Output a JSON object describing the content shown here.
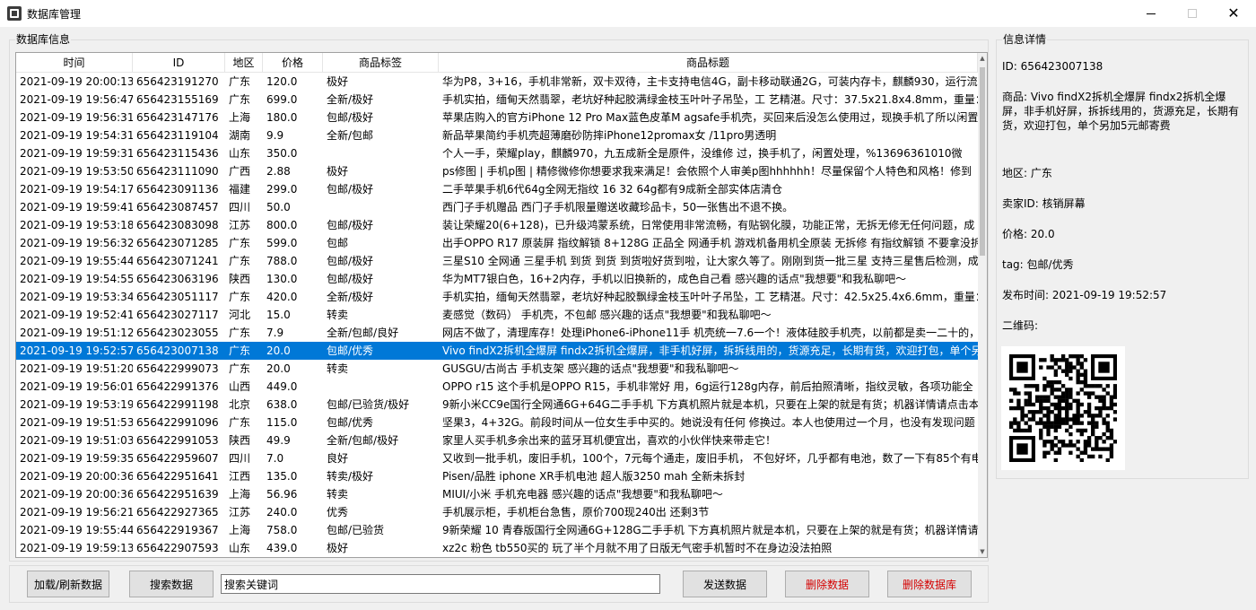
{
  "window": {
    "title": "数据库管理"
  },
  "db_group": {
    "title": "数据库信息"
  },
  "info_group": {
    "title": "信息详情"
  },
  "table": {
    "columns": [
      "时间",
      "ID",
      "地区",
      "价格",
      "商品标签",
      "商品标题"
    ],
    "selected_index": 15,
    "rows": [
      [
        "2021-09-19 20:00:13",
        "656423191270",
        "广东",
        "120.0",
        "极好",
        "华为P8，3+16，手机非常新，双卡双待，主卡支持电信4G，副卡移动联通2G，可装内存卡，麒麟930，运行流"
      ],
      [
        "2021-09-19 19:56:47",
        "656423155169",
        "广东",
        "699.0",
        "全新/极好",
        "手机实拍，缅甸天然翡翠，老坑好种起胶满绿金枝玉叶叶子吊坠，工 艺精湛。尺寸：37.5x21.8x4.8mm，重量："
      ],
      [
        "2021-09-19 19:56:31",
        "656423147176",
        "上海",
        "180.0",
        "包邮/极好",
        "苹果店购入的官方iPhone 12 Pro Max蓝色皮革M agsafe手机壳，买回来后没怎么使用过，现换手机了所以闲置"
      ],
      [
        "2021-09-19 19:54:31",
        "656423119104",
        "湖南",
        "9.9",
        "全新/包邮",
        "新品苹果简约手机壳超薄磨砂防摔iPhone12promax女 /11pro男透明"
      ],
      [
        "2021-09-19 19:59:31",
        "656423115436",
        "山东",
        "350.0",
        "",
        "个人一手，荣耀play，麒麟970，九五成新全是原件，没维修 过，换手机了，闲置处理，%13696361010微"
      ],
      [
        "2021-09-19 19:53:50",
        "656423111090",
        "广西",
        "2.88",
        "极好",
        "ps修图 | 手机p图 | 精修微修你想要求我来满足！会依照个人审美p图hhhhhh！尽量保留个人特色和风格！修到"
      ],
      [
        "2021-09-19 19:54:17",
        "656423091136",
        "福建",
        "299.0",
        "包邮/极好",
        "二手苹果手机6代64g全网无指纹 16 32 64g都有9成新全部实体店清仓"
      ],
      [
        "2021-09-19 19:59:41",
        "656423087457",
        "四川",
        "50.0",
        "",
        "西门子手机赠品 西门子手机限量赠送收藏珍品卡，50一张售出不退不换。"
      ],
      [
        "2021-09-19 19:53:18",
        "656423083098",
        "江苏",
        "800.0",
        "包邮/极好",
        "装让荣耀20(6+128)，已升级鸿蒙系统，日常使用非常流畅，有贴钢化膜，功能正常，无拆无修无任何问题，成"
      ],
      [
        "2021-09-19 19:56:32",
        "656423071285",
        "广东",
        "599.0",
        "包邮",
        "出手OPPO R17 原装屏 指纹解锁 8+128G 正品全 网通手机 游戏机备用机全原装 无拆修 有指纹解锁 不要拿没拆"
      ],
      [
        "2021-09-19 19:55:44",
        "656423071241",
        "广东",
        "788.0",
        "包邮/极好",
        "三星S10 全网通 三星手机 到货 到货 到货啦好货到啦，让大家久等了。刚刚到货一批三星 支持三星售后检测，成"
      ],
      [
        "2021-09-19 19:54:55",
        "656423063196",
        "陕西",
        "130.0",
        "包邮/极好",
        "华为MT7银白色，16+2内存，手机以旧换新的，成色自己看 感兴趣的话点\"我想要\"和我私聊吧～"
      ],
      [
        "2021-09-19 19:53:34",
        "656423051117",
        "广东",
        "420.0",
        "全新/极好",
        "手机实拍，缅甸天然翡翠，老坑好种起胶飘绿金枝玉叶叶子吊坠，工 艺精湛。尺寸：42.5x25.4x6.6mm，重量："
      ],
      [
        "2021-09-19 19:52:41",
        "656423027117",
        "河北",
        "15.0",
        "转卖",
        "麦感觉（数码） 手机壳，不包邮 感兴趣的话点\"我想要\"和我私聊吧～"
      ],
      [
        "2021-09-19 19:51:12",
        "656423023055",
        "广东",
        "7.9",
        "全新/包邮/良好",
        "网店不做了，清理库存！处理iPhone6-iPhone11手 机壳统一7.6一个！液体硅胶手机壳，以前都是卖一二十的，"
      ],
      [
        "2021-09-19 19:52:57",
        "656423007138",
        "广东",
        "20.0",
        "包邮/优秀",
        "Vivo findX2拆机全爆屏 findx2拆机全爆屏，非手机好屏，拆拆线用的，货源充足，长期有货，欢迎打包，单个另"
      ],
      [
        "2021-09-19 19:51:20",
        "656422999073",
        "广东",
        "20.0",
        "转卖",
        "GUSGU/古尚古 手机支架 感兴趣的话点\"我想要\"和我私聊吧～"
      ],
      [
        "2021-09-19 19:56:01",
        "656422991376",
        "山西",
        "449.0",
        "",
        "OPPO  r15  这个手机是OPPO R15，手机非常好 用，6g运行128g内存，前后拍照清晰，指纹灵敏，各项功能全"
      ],
      [
        "2021-09-19 19:53:19",
        "656422991198",
        "北京",
        "638.0",
        "包邮/已验货/极好",
        "9新小米CC9e国行全网通6G+64G二手手机 下方真机照片就是本机，只要在上架的就是有货；机器详情请点击本"
      ],
      [
        "2021-09-19 19:51:53",
        "656422991096",
        "广东",
        "115.0",
        "包邮/优秀",
        "坚果3，4+32G。前段时间从一位女生手中买的。她说没有任何 修换过。本人也使用过一个月，也没有发现问题"
      ],
      [
        "2021-09-19 19:51:03",
        "656422991053",
        "陕西",
        "49.9",
        "全新/包邮/极好",
        "家里人买手机多余出来的蓝牙耳机便宜出，喜欢的小伙伴快来带走它！"
      ],
      [
        "2021-09-19 19:59:35",
        "656422959607",
        "四川",
        "7.0",
        "良好",
        "又收到一批手机，废旧手机，100个，7元每个通走，废旧手机， 不包好坏，几乎都有电池，数了一下有85个有电"
      ],
      [
        "2021-09-19 20:00:36",
        "656422951641",
        "江西",
        "135.0",
        "转卖/极好",
        "Pisen/品胜 iphone XR手机电池 超人版3250 mah 全新未拆封"
      ],
      [
        "2021-09-19 20:00:36",
        "656422951639",
        "上海",
        "56.96",
        "转卖",
        "MIUI/小米 手机充电器 感兴趣的话点\"我想要\"和我私聊吧～"
      ],
      [
        "2021-09-19 19:56:21",
        "656422927365",
        "江苏",
        "240.0",
        "优秀",
        "手机展示柜，手机柜台急售，原价700现240出 还剩3节"
      ],
      [
        "2021-09-19 19:55:44",
        "656422919367",
        "上海",
        "758.0",
        "包邮/已验货",
        "9新荣耀 10 青春版国行全网通6G+128G二手手机 下方真机照片就是本机，只要在上架的就是有货；机器详情请"
      ],
      [
        "2021-09-19 19:59:13",
        "656422907593",
        "山东",
        "439.0",
        "极好",
        "xz2c 粉色 tb550买的 玩了半个月就不用了日版无气密手机暂时不在身边没法拍照"
      ]
    ]
  },
  "info": {
    "id_line": "ID: 656423007138",
    "product_line": "商品: Vivo findX2拆机全爆屏 findx2拆机全爆屏，非手机好屏，拆拆线用的，货源充足，长期有货，欢迎打包，单个另加5元邮寄费",
    "region_line": "地区: 广东",
    "seller_line": "卖家ID: 核销屏幕",
    "price_line": "价格: 20.0",
    "tag_line": "tag: 包邮/优秀",
    "time_line": "发布时间: 2021-09-19 19:52:57",
    "qr_label": "二维码:"
  },
  "controls": {
    "load_button": "加载/刷新数据",
    "search_button": "搜索数据",
    "search_value": "搜索关键词",
    "send_button": "发送数据",
    "delete_button": "删除数据",
    "delete_db_button": "删除数据库"
  },
  "colors": {
    "selection": "#0078d7",
    "danger_text": "#d40000"
  }
}
